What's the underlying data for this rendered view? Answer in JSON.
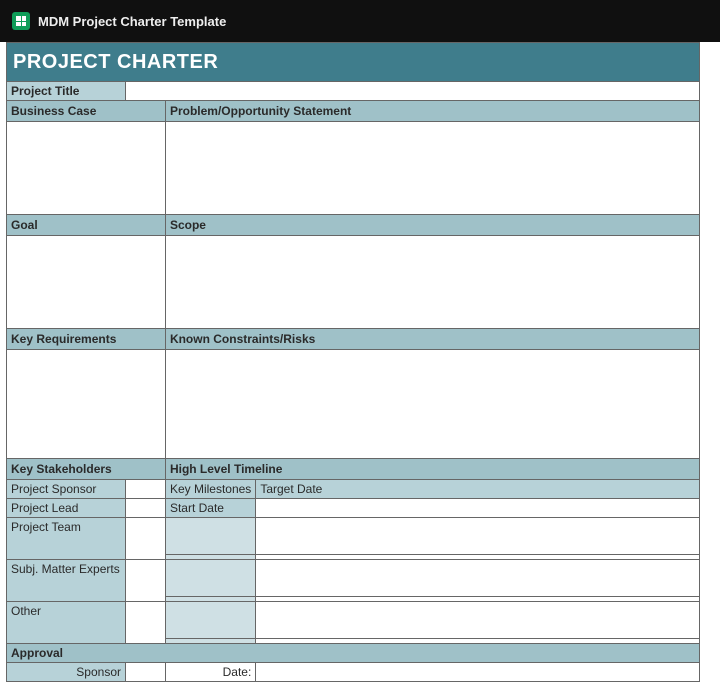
{
  "document": {
    "title": "MDM Project Charter Template"
  },
  "header": {
    "title": "PROJECT CHARTER"
  },
  "projectTitle": {
    "label": "Project Title",
    "value": ""
  },
  "sections": {
    "businessCase": {
      "label": "Business Case",
      "value": ""
    },
    "problem": {
      "label": "Problem/Opportunity Statement",
      "value": ""
    },
    "goal": {
      "label": "Goal",
      "value": ""
    },
    "scope": {
      "label": "Scope",
      "value": ""
    },
    "keyReq": {
      "label": "Key Requirements",
      "value": ""
    },
    "risks": {
      "label": "Known Constraints/Risks",
      "value": ""
    },
    "stakeholders": {
      "label": "Key Stakeholders"
    },
    "timeline": {
      "label": "High Level Timeline"
    }
  },
  "stakeholders": {
    "projectSponsor": {
      "label": "Project Sponsor",
      "value": ""
    },
    "projectLead": {
      "label": "Project Lead",
      "value": ""
    },
    "projectTeam": {
      "label": "Project Team",
      "value": ""
    },
    "sme": {
      "label": "Subj. Matter Experts",
      "value": ""
    },
    "other": {
      "label": "Other",
      "value": ""
    }
  },
  "timeline": {
    "colMilestones": "Key Milestones",
    "colTarget": "Target Date",
    "startDate": {
      "label": "Start Date",
      "value": ""
    },
    "rows": [
      {
        "milestone": "",
        "target": ""
      },
      {
        "milestone": "",
        "target": ""
      },
      {
        "milestone": "",
        "target": ""
      },
      {
        "milestone": "",
        "target": ""
      }
    ]
  },
  "approval": {
    "label": "Approval",
    "sponsorLabel": "Sponsor",
    "sponsorValue": "",
    "dateLabel": "Date:",
    "dateValue": ""
  }
}
